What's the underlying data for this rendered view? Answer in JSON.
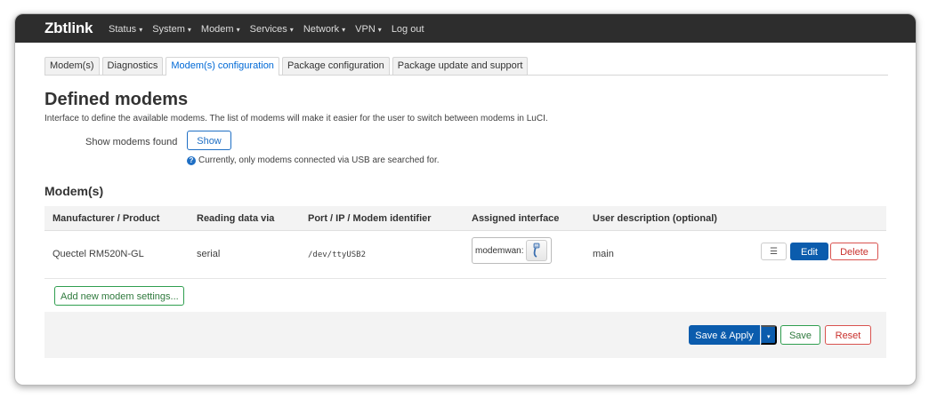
{
  "brand": "Zbtlink",
  "menu": [
    {
      "label": "Status",
      "caret": true
    },
    {
      "label": "System",
      "caret": true
    },
    {
      "label": "Modem",
      "caret": true
    },
    {
      "label": "Services",
      "caret": true
    },
    {
      "label": "Network",
      "caret": true
    },
    {
      "label": "VPN",
      "caret": true
    },
    {
      "label": "Log out",
      "caret": false
    }
  ],
  "tabs": [
    "Modem(s)",
    "Diagnostics",
    "Modem(s) configuration",
    "Package configuration",
    "Package update and support"
  ],
  "active_tab": "Modem(s) configuration",
  "page": {
    "title": "Defined modems",
    "description": "Interface to define the available modems. The list of modems will make it easier for the user to switch between modems in LuCI.",
    "show_label": "Show modems found",
    "show_button": "Show",
    "hint": "Currently, only modems connected via USB are searched for."
  },
  "section": {
    "title": "Modem(s)",
    "columns": [
      "Manufacturer / Product",
      "Reading data via",
      "Port / IP / Modem identifier",
      "Assigned interface",
      "User description (optional)"
    ],
    "rows": [
      {
        "product": "Quectel RM520N-GL",
        "via": "serial",
        "port": "/dev/ttyUSB2",
        "interface": "modemwan:",
        "description": "main"
      }
    ],
    "row_actions": {
      "more": "☰",
      "edit": "Edit",
      "delete": "Delete"
    },
    "add_button": "Add new modem settings..."
  },
  "footer": {
    "apply": "Save & Apply",
    "apply_caret": "▾",
    "save": "Save",
    "reset": "Reset"
  },
  "colors": {
    "topbar": "#2d2d2d",
    "primary": "#0b5cad",
    "link": "#0069d6",
    "positive": "#2f9e4f",
    "negative": "#d9534f"
  },
  "icons": {
    "hint": "info-icon",
    "interface": "network-cable-icon"
  }
}
